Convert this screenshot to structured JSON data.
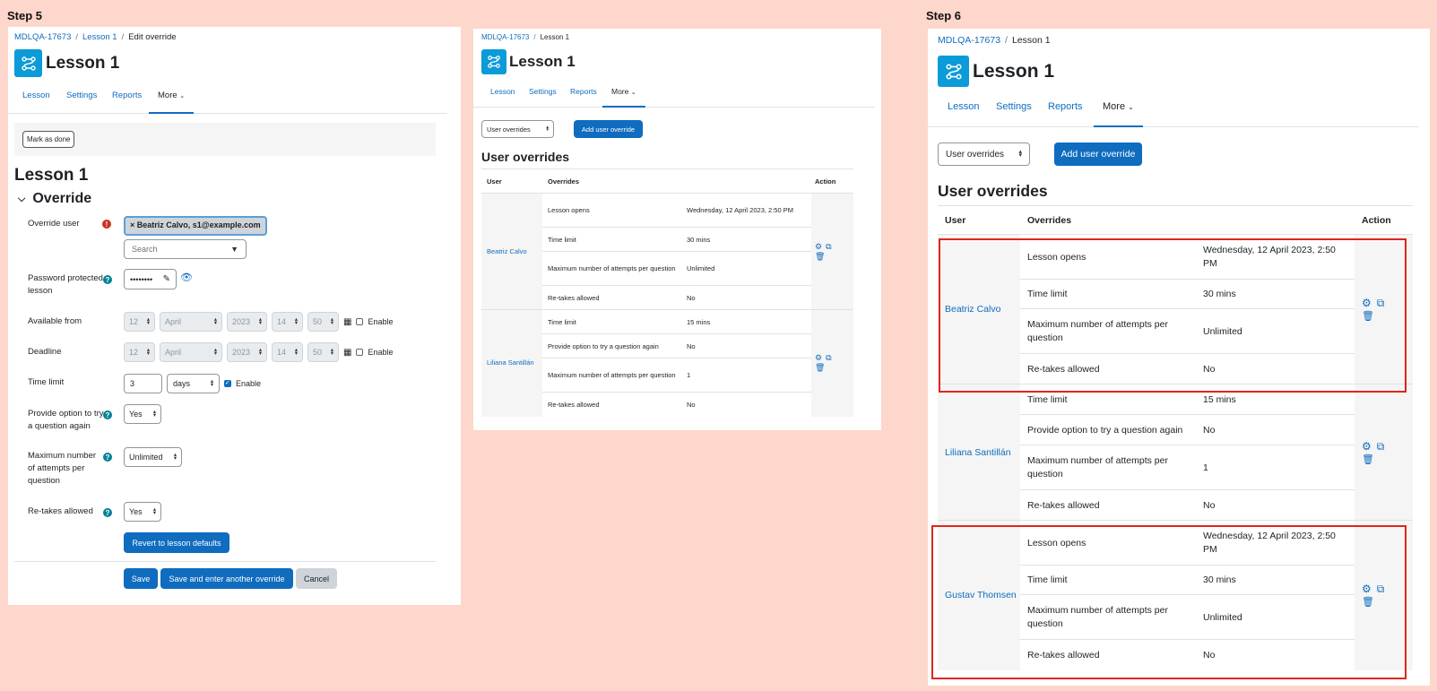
{
  "steps": {
    "step5": "Step 5",
    "step6": "Step 6"
  },
  "breadcrumb": {
    "course": "MDLQA-17673",
    "lesson": "Lesson 1",
    "edit": "Edit override",
    "separator": "/"
  },
  "page_title": "Lesson 1",
  "nav": {
    "lesson": "Lesson",
    "settings": "Settings",
    "reports": "Reports",
    "more": "More"
  },
  "edit_form": {
    "mark_as_done": "Mark as done",
    "heading": "Lesson 1",
    "section": "Override",
    "override_user_label": "Override user",
    "selected_user": "× Beatriz Calvo, s1@example.com",
    "search_placeholder": "Search",
    "password_label": "Password protected lesson",
    "password_value": "••••••••",
    "available_from_label": "Available from",
    "deadline_label": "Deadline",
    "date_day": "12",
    "date_month": "April",
    "date_year": "2023",
    "date_hour": "14",
    "date_minute": "50",
    "enable_label": "Enable",
    "time_limit_label": "Time limit",
    "time_limit_value": "3",
    "time_limit_unit": "days",
    "try_again_label": "Provide option to try a question again",
    "try_again_value": "Yes",
    "max_attempts_label": "Maximum number of attempts per question",
    "max_attempts_value": "Unlimited",
    "retakes_label": "Re-takes allowed",
    "retakes_value": "Yes",
    "revert_button": "Revert to lesson defaults",
    "save_button": "Save",
    "save_another_button": "Save and enter another override",
    "cancel_button": "Cancel"
  },
  "overrides_page": {
    "select_value": "User overrides",
    "add_button": "Add user override",
    "heading": "User overrides",
    "col_user": "User",
    "col_overrides": "Overrides",
    "col_action": "Action"
  },
  "users": [
    {
      "name": "Beatriz Calvo",
      "rows": [
        {
          "label": "Lesson opens",
          "value": "Wednesday, 12 April 2023, 2:50 PM"
        },
        {
          "label": "Time limit",
          "value": "30 mins"
        },
        {
          "label": "Maximum number of attempts per question",
          "value": "Unlimited"
        },
        {
          "label": "Re-takes allowed",
          "value": "No"
        }
      ]
    },
    {
      "name": "Liliana Santillán",
      "rows": [
        {
          "label": "Time limit",
          "value": "15 mins"
        },
        {
          "label": "Provide option to try a question again",
          "value": "No"
        },
        {
          "label": "Maximum number of attempts per question",
          "value": "1"
        },
        {
          "label": "Re-takes allowed",
          "value": "No"
        }
      ]
    },
    {
      "name": "Gustav Thomsen",
      "rows": [
        {
          "label": "Lesson opens",
          "value": "Wednesday, 12 April 2023, 2:50 PM"
        },
        {
          "label": "Time limit",
          "value": "30 mins"
        },
        {
          "label": "Maximum number of attempts per question",
          "value": "Unlimited"
        },
        {
          "label": "Re-takes allowed",
          "value": "No"
        }
      ]
    }
  ],
  "colors": {
    "background": "#fdd7cb",
    "link": "#0f6cbf",
    "icon_bg": "#0b9bd8",
    "highlight": "#e0251b"
  }
}
